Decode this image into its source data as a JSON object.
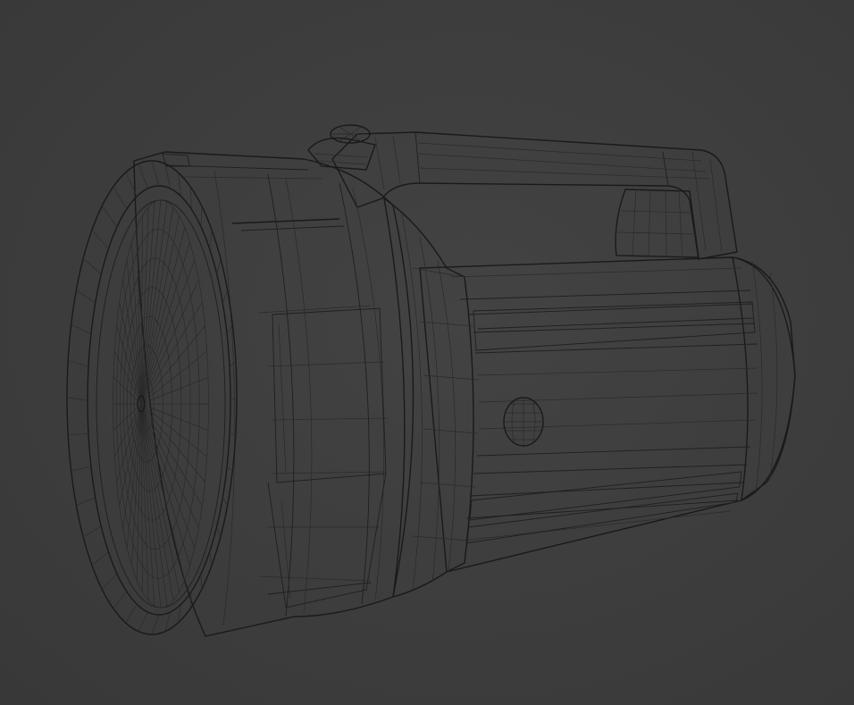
{
  "scene": {
    "background_color": "#3d3d3d",
    "mesh_color": "#8a8a8a",
    "mesh_light_color": "#a3a3a3",
    "mesh_dark_color": "#5e5e5e",
    "wire_color": "#1f1f1f"
  },
  "model": {
    "subject": "flashlight-wireframe-mesh",
    "lens_spokes": 48,
    "lens_rings": 7
  }
}
